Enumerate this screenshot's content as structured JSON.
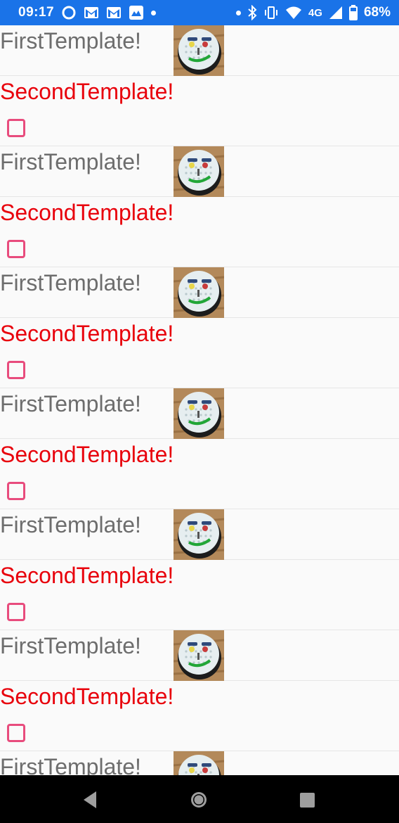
{
  "status_bar": {
    "time": "09:17",
    "network": "4G",
    "battery_percent": "68%"
  },
  "list": {
    "first_label": "FirstTemplate!",
    "second_label": "SecondTemplate!",
    "groups": [
      {
        "first": "FirstTemplate!",
        "second": "SecondTemplate!",
        "checked": false
      },
      {
        "first": "FirstTemplate!",
        "second": "SecondTemplate!",
        "checked": false
      },
      {
        "first": "FirstTemplate!",
        "second": "SecondTemplate!",
        "checked": false
      },
      {
        "first": "FirstTemplate!",
        "second": "SecondTemplate!",
        "checked": false
      },
      {
        "first": "FirstTemplate!",
        "second": "SecondTemplate!",
        "checked": false
      },
      {
        "first": "FirstTemplate!",
        "second": "SecondTemplate!",
        "checked": false
      },
      {
        "first": "FirstTemplate!"
      }
    ]
  },
  "colors": {
    "status_bar_bg": "#1a73e8",
    "first_text": "#6d6d6d",
    "second_text": "#e8000b",
    "checkbox_border": "#e84c7d"
  },
  "icons": {
    "status": [
      "circle-icon",
      "gmail-icon",
      "gmail-icon",
      "mountain-app-icon",
      "dot-icon"
    ],
    "system": [
      "dot-icon",
      "bluetooth-icon",
      "vibrate-icon",
      "wifi-icon",
      "signal-icon",
      "battery-icon"
    ],
    "nav": [
      "back-icon",
      "home-icon",
      "recents-icon"
    ]
  }
}
